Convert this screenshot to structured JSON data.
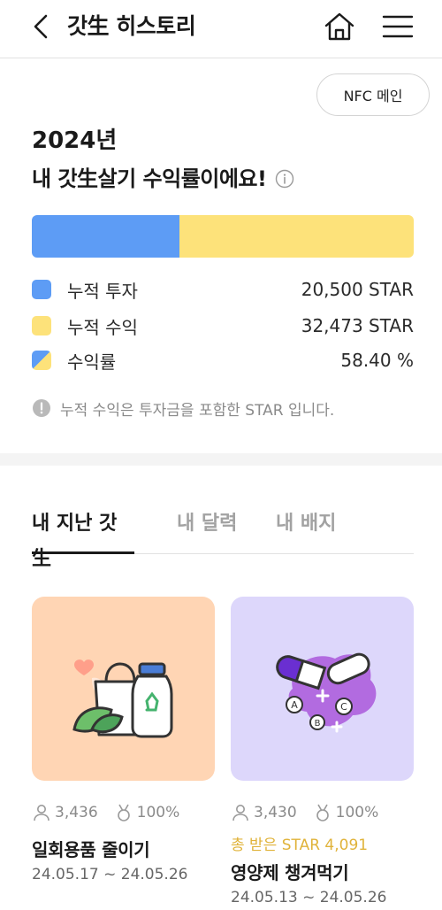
{
  "header": {
    "title": "갓生 히스토리"
  },
  "summary": {
    "nfc_button": "NFC 메인",
    "year": "2024년",
    "headline": "내 갓生살기 수익률이에요!",
    "investment_fraction": 0.387,
    "legend": [
      {
        "label": "누적 투자",
        "value": "20,500 STAR",
        "color": "#5d9cf5"
      },
      {
        "label": "누적 수익",
        "value": "32,473 STAR",
        "color": "#fde27a"
      },
      {
        "label": "수익률",
        "value": "58.40 %"
      }
    ],
    "note": "누적 수익은 투자금을 포함한 STAR 입니다."
  },
  "tabs": [
    {
      "label": "내 지난 갓生"
    },
    {
      "label": "내 달력"
    },
    {
      "label": "내 배지"
    }
  ],
  "cards": [
    {
      "participants": "3,436",
      "rate": "100%",
      "title": "일회용품 줄이기",
      "date": "24.05.17 ~ 24.05.26"
    },
    {
      "participants": "3,430",
      "rate": "100%",
      "received": "총 받은 STAR 4,091",
      "title": "영양제 챙겨먹기",
      "date": "24.05.13 ~ 24.05.26"
    }
  ],
  "icons": {
    "back": "chevron-left-icon",
    "home": "home-icon",
    "menu": "hamburger-menu-icon",
    "info": "info-icon",
    "notice": "exclamation-circle-icon",
    "person": "person-icon",
    "medal": "medal-icon"
  }
}
